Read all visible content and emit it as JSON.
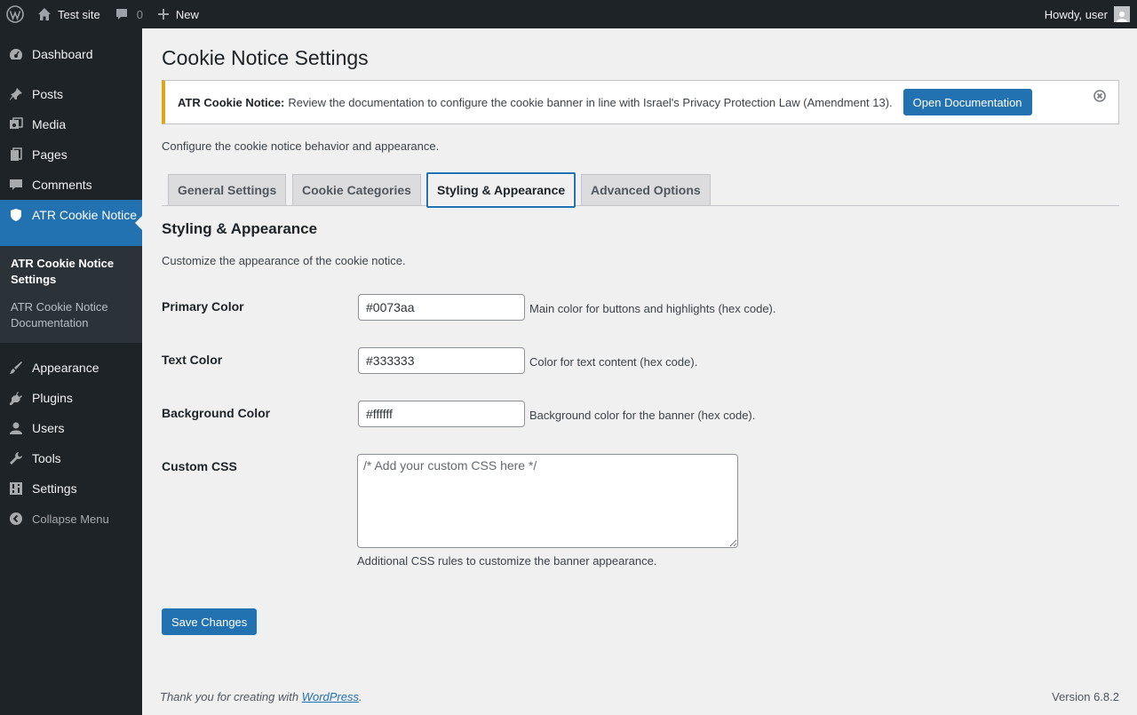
{
  "adminbar": {
    "site_name": "Test site",
    "comments_count": "0",
    "new_label": "New",
    "greeting": "Howdy, user"
  },
  "sidebar": {
    "items_top": [
      {
        "label": "Dashboard",
        "icon": "dashboard-icon"
      },
      {
        "label": "Posts",
        "icon": "pin-icon"
      },
      {
        "label": "Media",
        "icon": "media-icon"
      },
      {
        "label": "Pages",
        "icon": "pages-icon"
      },
      {
        "label": "Comments",
        "icon": "comment-icon"
      }
    ],
    "active_item": {
      "label": "ATR Cookie Notice",
      "icon": "shield-icon"
    },
    "submenu": [
      {
        "label": "ATR Cookie Notice Settings",
        "current": true
      },
      {
        "label": "ATR Cookie Notice Documentation",
        "current": false
      }
    ],
    "items_bottom": [
      {
        "label": "Appearance",
        "icon": "brush-icon"
      },
      {
        "label": "Plugins",
        "icon": "plugin-icon"
      },
      {
        "label": "Users",
        "icon": "user-icon"
      },
      {
        "label": "Tools",
        "icon": "wrench-icon"
      },
      {
        "label": "Settings",
        "icon": "settings-icon"
      }
    ],
    "collapse_label": "Collapse Menu"
  },
  "page": {
    "title": "Cookie Notice Settings",
    "notice": {
      "strong": "ATR Cookie Notice:",
      "message": "Review the documentation to configure the cookie banner in line with Israel's Privacy Protection Law (Amendment 13).",
      "button": "Open Documentation"
    },
    "intro": "Configure the cookie notice behavior and appearance.",
    "tabs": [
      {
        "label": "General Settings",
        "active": false
      },
      {
        "label": "Cookie Categories",
        "active": false
      },
      {
        "label": "Styling & Appearance",
        "active": true
      },
      {
        "label": "Advanced Options",
        "active": false
      }
    ],
    "section_title": "Styling & Appearance",
    "section_desc": "Customize the appearance of the cookie notice.",
    "fields": {
      "primary": {
        "label": "Primary Color",
        "value": "#0073aa",
        "desc": "Main color for buttons and highlights (hex code)."
      },
      "text": {
        "label": "Text Color",
        "value": "#333333",
        "desc": "Color for text content (hex code)."
      },
      "background": {
        "label": "Background Color",
        "value": "#ffffff",
        "desc": "Background color for the banner (hex code)."
      },
      "css": {
        "label": "Custom CSS",
        "placeholder": "/* Add your custom CSS here */",
        "value": "",
        "desc": "Additional CSS rules to customize the banner appearance."
      }
    },
    "save_button": "Save Changes"
  },
  "footer": {
    "thanks_prefix": "Thank you for creating with ",
    "thanks_link": "WordPress",
    "thanks_suffix": ".",
    "version": "Version 6.8.2"
  },
  "colors": {
    "accent": "#2271b1",
    "adminbar_bg": "#1d2327",
    "notice_border": "#dba617"
  }
}
